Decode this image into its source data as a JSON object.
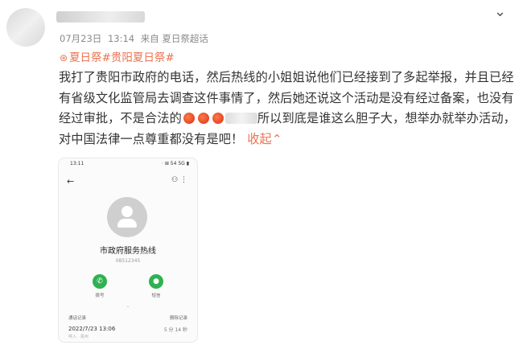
{
  "post": {
    "meta": {
      "date": "07月23日",
      "time": "13:14",
      "source": "来自 夏日祭超话"
    },
    "tags": "夏日祭#贵阳夏日祭#",
    "body": {
      "part1": "我打了贵阳市政府的电话，然后热线的小姐姐说他们已经接到了多起举报，并且已经有省级文化监管局去调查这件事情了，然后她还说这个活动是没有经过备案，也没有经过审批，不是合法的",
      "part2": "所以到底是谁这么胆子大，想举办就举办活动，对中国法律一点尊重都没有是吧！",
      "collapse": "收起"
    }
  },
  "phone": {
    "status_time": "13:11",
    "status_right": "⋅ ⊞ 54 5G ▮",
    "contact_name": "市政府服务热线",
    "contact_number": "08512345",
    "call_label": "拨号",
    "msg_label": "短信",
    "more_label": "⌄",
    "records_label": "通话记录",
    "delete_label": "删除记录",
    "call_date": "2022/7/23 13:06",
    "call_duration": "5 分 14 秒",
    "call_sub": "呼入 · 贵州"
  }
}
